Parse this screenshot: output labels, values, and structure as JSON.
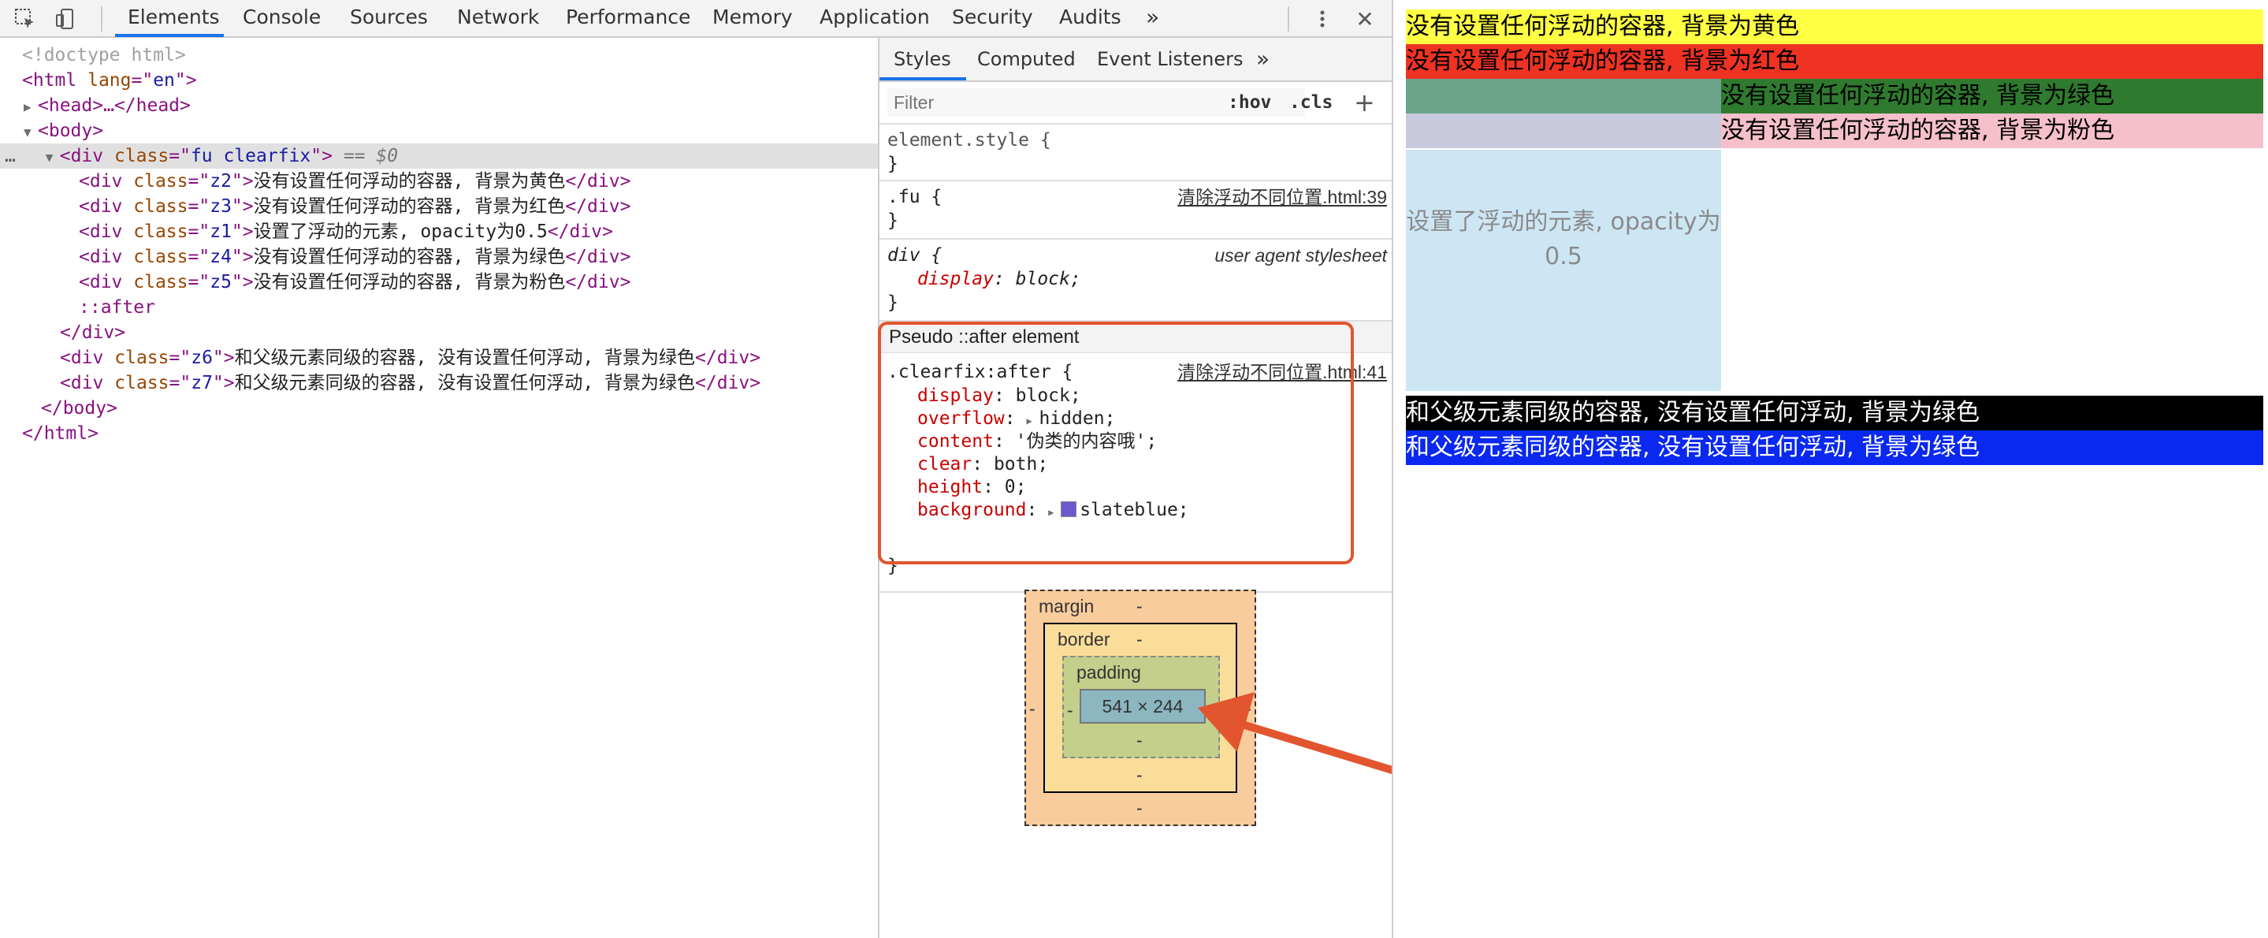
{
  "toolbar": {
    "tabs": [
      "Elements",
      "Console",
      "Sources",
      "Network",
      "Performance",
      "Memory",
      "Application",
      "Security",
      "Audits"
    ],
    "more": "»",
    "close": "✕"
  },
  "dom": {
    "doctype": "<!doctype html>",
    "html_open_tag": "html",
    "html_attr": "lang",
    "html_attr_val": "en",
    "head": "<head>…</head>",
    "body_open": "<body>",
    "div_tag": "div",
    "class_attr": "class",
    "fu_class": "fu clearfix",
    "selected_marker": "== $0",
    "children": [
      {
        "cls": "z2",
        "text": "没有设置任何浮动的容器, 背景为黄色"
      },
      {
        "cls": "z3",
        "text": "没有设置任何浮动的容器, 背景为红色"
      },
      {
        "cls": "z1",
        "text": "设置了浮动的元素, opacity为0.5"
      },
      {
        "cls": "z4",
        "text": "没有设置任何浮动的容器, 背景为绿色"
      },
      {
        "cls": "z5",
        "text": "没有设置任何浮动的容器, 背景为粉色"
      }
    ],
    "after": "::after",
    "div_close": "</div>",
    "siblings": [
      {
        "cls": "z6",
        "text": "和父级元素同级的容器, 没有设置任何浮动, 背景为绿色"
      },
      {
        "cls": "z7",
        "text": "和父级元素同级的容器, 没有设置任何浮动, 背景为绿色"
      }
    ],
    "body_close": "</body>",
    "html_close": "</html>",
    "ellipsis": "…"
  },
  "styles": {
    "subtabs": [
      "Styles",
      "Computed",
      "Event Listeners"
    ],
    "more": "»",
    "filter_placeholder": "Filter",
    "hov": ":hov",
    "cls": ".cls",
    "plus": "+",
    "element_style": "element.style {",
    "close_brace": "}",
    "fu_selector": ".fu {",
    "fu_source": "清除浮动不同位置.html:39",
    "div_selector": "div {",
    "div_source": "user agent stylesheet",
    "div_prop": "display",
    "div_val": "block;",
    "pseudo_header": "Pseudo ::after element",
    "clearfix_selector": ".clearfix:after {",
    "clearfix_source": "清除浮动不同位置.html:41",
    "props": [
      {
        "name": "display",
        "value": "block;"
      },
      {
        "name": "overflow",
        "value": "hidden;"
      },
      {
        "name": "content",
        "value": "'伪类的内容哦';"
      },
      {
        "name": "clear",
        "value": "both;"
      },
      {
        "name": "height",
        "value": "0;"
      },
      {
        "name": "background",
        "value": "slateblue;"
      }
    ],
    "swatch_color": "#6a5acd"
  },
  "boxmodel": {
    "margin": "margin",
    "border": "border",
    "padding": "padding",
    "content": "541 × 244",
    "dash": "-"
  },
  "page": {
    "bars": [
      {
        "text": "没有设置任何浮动的容器, 背景为黄色",
        "bg": "#ffff44",
        "fg": "#000000"
      },
      {
        "text": "没有设置任何浮动的容器, 背景为红色",
        "bg": "#ee3322",
        "fg": "#000000"
      },
      {
        "text": "没有设置任何浮动的容器, 背景为绿色",
        "bg": "#2f7a2f",
        "fg": "#000000"
      },
      {
        "text": "没有设置任何浮动的容器, 背景为粉色",
        "bg": "#f6c0cb",
        "fg": "#000000"
      }
    ],
    "float_text": "设置了浮动的元素, opacity为0.5",
    "sibling_bars": [
      {
        "text": "和父级元素同级的容器, 没有设置任何浮动, 背景为绿色",
        "bg": "#000000",
        "fg": "#ffffff"
      },
      {
        "text": "和父级元素同级的容器, 没有设置任何浮动, 背景为绿色",
        "bg": "#0a28f0",
        "fg": "#ffffff"
      }
    ]
  },
  "colors": {
    "accent": "#1a73e8",
    "highlight": "#e2552f"
  }
}
